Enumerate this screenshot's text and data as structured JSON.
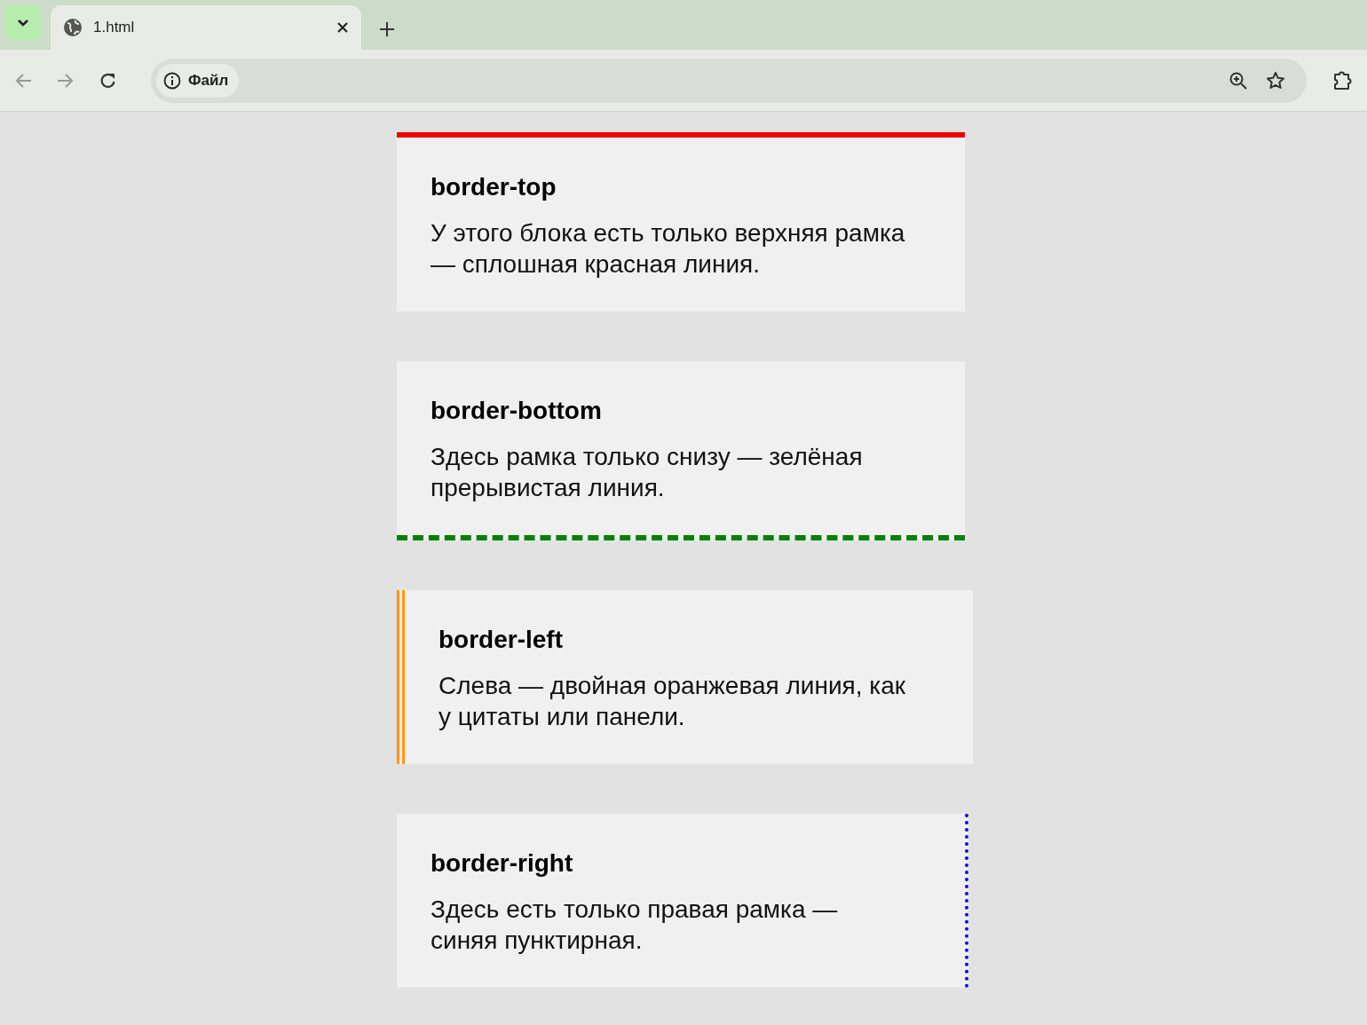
{
  "browser": {
    "tab_title": "1.html",
    "address_chip": "Файл"
  },
  "cards": [
    {
      "title": "border-top",
      "text": "У этого блока есть только верхняя рамка — сплошная красная линия.",
      "kind": "top",
      "color": "#ee0000"
    },
    {
      "title": "border-bottom",
      "text": "Здесь рамка только снизу — зелёная прерывистая линия.",
      "kind": "bottom",
      "color": "#008000"
    },
    {
      "title": "border-left",
      "text": "Слева — двойная оранжевая линия, как у цитаты или панели.",
      "kind": "left",
      "color": "#ff9900"
    },
    {
      "title": "border-right",
      "text": "Здесь есть только правая рамка — синяя пунктирная.",
      "kind": "right",
      "color": "#0000ee"
    }
  ]
}
